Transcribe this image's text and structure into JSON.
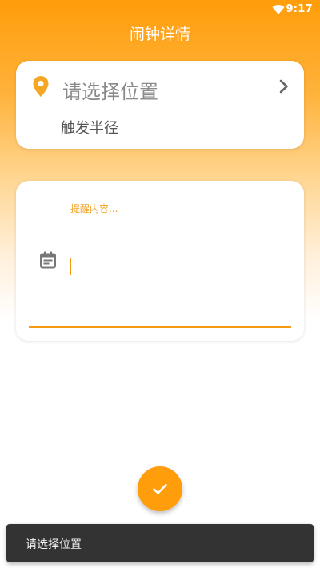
{
  "status_bar": {
    "time": "9:17",
    "wifi_icon": "wifi-icon"
  },
  "header": {
    "title": "闹钟详情"
  },
  "location_card": {
    "location_placeholder": "请选择位置",
    "radius_label": "触发半径",
    "icons": {
      "leading": "location-pin-icon",
      "trailing": "chevron-right-icon"
    }
  },
  "content_card": {
    "hint": "提醒内容...",
    "value": "",
    "icon": "calendar-note-icon"
  },
  "fab": {
    "icon": "check-icon"
  },
  "snackbar": {
    "message": "请选择位置"
  },
  "colors": {
    "accent": "#ff9d0a",
    "accent_line": "#f39a10",
    "snackbar_bg": "#333333",
    "placeholder_text": "#8a8a8a"
  }
}
